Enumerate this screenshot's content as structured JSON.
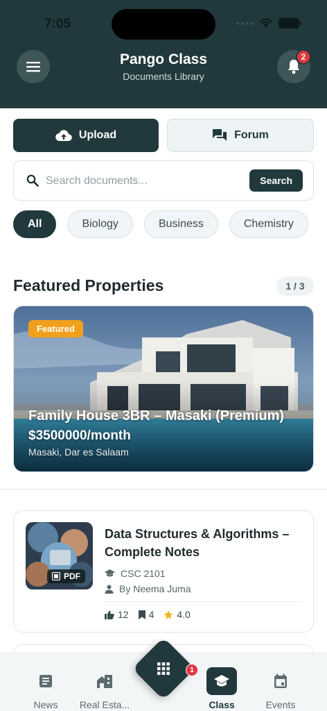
{
  "status": {
    "time": "7:05"
  },
  "header": {
    "title": "Pango Class",
    "subtitle": "Documents Library",
    "notification_count": "2"
  },
  "actions": {
    "upload_label": "Upload",
    "forum_label": "Forum"
  },
  "search": {
    "placeholder": "Search documents...",
    "button_label": "Search"
  },
  "filters": {
    "chips": [
      "All",
      "Biology",
      "Business",
      "Chemistry"
    ],
    "selected": "All"
  },
  "featured": {
    "section_title": "Featured Properties",
    "pager": "1 / 3",
    "badge": "Featured",
    "title": "Family House 3BR – Masaki (Premium)",
    "price": "$3500000/month",
    "location": "Masaki, Dar es Salaam"
  },
  "document": {
    "file_type": "PDF",
    "title": "Data Structures & Algorithms – Complete Notes",
    "course_code": "CSC 2101",
    "author": "By Neema Juma",
    "likes": "12",
    "bookmarks": "4",
    "rating": "4.0"
  },
  "bottom_nav": {
    "items": [
      "News",
      "Real Esta...",
      "Class",
      "Events"
    ],
    "active": "Class",
    "fab_badge": "1"
  },
  "colors": {
    "primary": "#21393c",
    "accent": "#f2a01c",
    "badge": "#e0383e"
  }
}
